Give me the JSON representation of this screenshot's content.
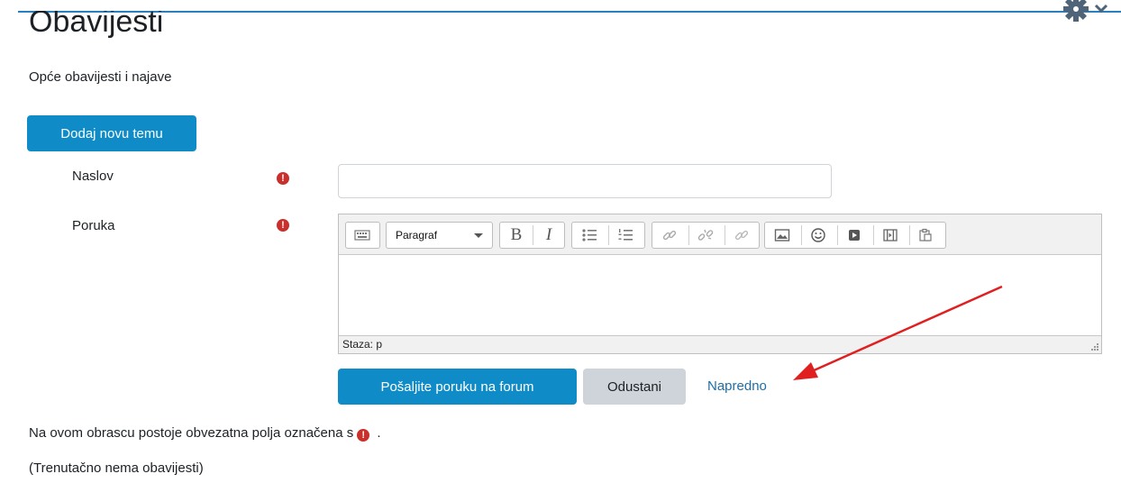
{
  "page": {
    "title": "Obavijesti",
    "intro": "Opće obavijesti i najave"
  },
  "actions": {
    "add_topic": "Dodaj novu temu"
  },
  "form": {
    "subject_label": "Naslov",
    "message_label": "Poruka",
    "required_icon_label": "!",
    "subject_value": "",
    "editor": {
      "format_select": "Paragraf",
      "toolbar_icons": [
        "keyboard-icon",
        "bold-icon",
        "italic-icon",
        "bullet-list-icon",
        "numbered-list-icon",
        "link-icon",
        "unlink-icon",
        "anchor-icon",
        "image-icon",
        "emoticon-icon",
        "media-icon",
        "video-icon",
        "paste-icon"
      ],
      "bold_label": "B",
      "italic_label": "I",
      "status_path": "Staza: p"
    },
    "submit_label": "Pošaljite poruku na forum",
    "cancel_label": "Odustani",
    "advanced_label": "Napredno"
  },
  "notes": {
    "required_before": "Na ovom obrascu postoje obvezatna polja označena s",
    "required_after": ".",
    "empty": "(Trenutačno nema obavijesti)"
  },
  "colors": {
    "primary": "#0f8cc7",
    "required": "#c9302c",
    "link": "#1e6ea7",
    "annotation_arrow": "#e02020"
  }
}
